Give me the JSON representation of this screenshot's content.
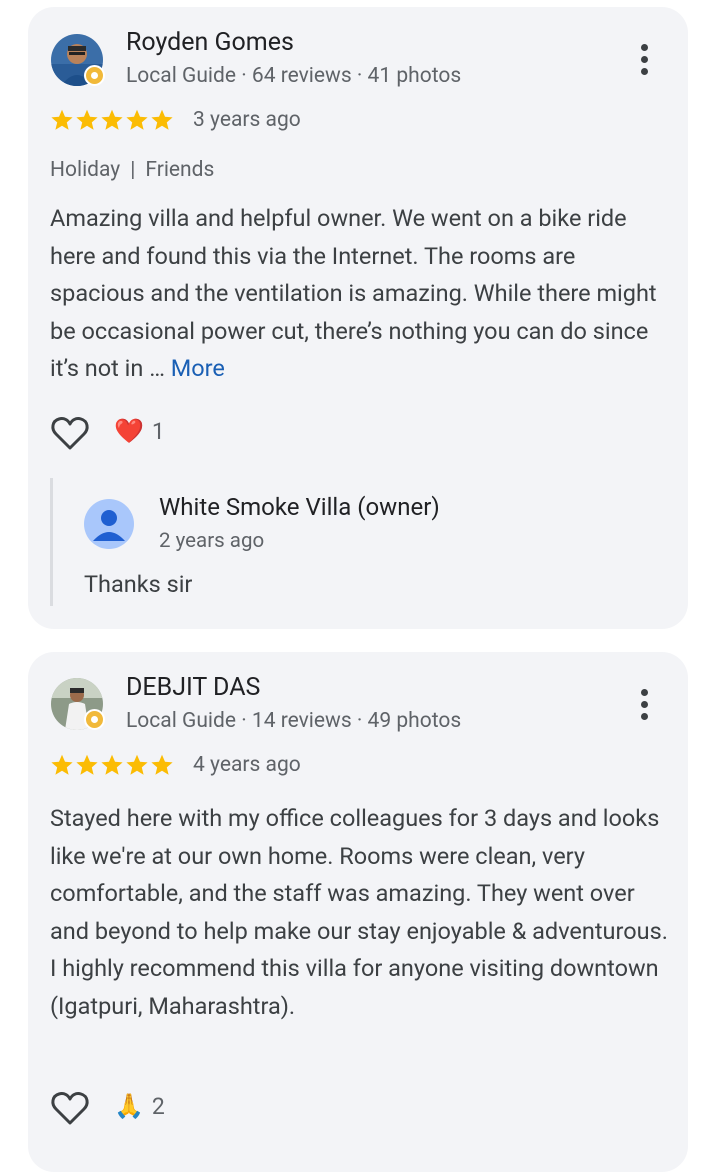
{
  "reviews": [
    {
      "name": "Royden Gomes",
      "meta": "Local Guide · 64 reviews · 41 photos",
      "stars": 5,
      "time": "3 years ago",
      "tags": [
        "Holiday",
        "Friends"
      ],
      "text": "Amazing villa and helpful owner. We went on a bike ride here and found this via the Internet. The rooms are spacious and the ventilation is amazing. While there might be occasional power cut, there’s nothing you can do since it’s not in … ",
      "more_label": "More",
      "reaction_emoji": "❤️",
      "reaction_count": "1",
      "owner_reply": {
        "name": "White Smoke Villa (owner)",
        "time": "2 years ago",
        "text": "Thanks sir"
      }
    },
    {
      "name": "DEBJIT DAS",
      "meta": "Local Guide · 14 reviews · 49 photos",
      "stars": 5,
      "time": "4 years ago",
      "text": "Stayed here with my office colleagues for 3 days and looks like we're at our own home. Rooms were clean, very comfortable, and the staff was amazing. They went over and beyond to help make our stay enjoyable & adventurous. I highly recommend this villa for anyone visiting downtown (Igatpuri, Maharashtra).",
      "reaction_emoji": "🙏",
      "reaction_count": "2"
    }
  ],
  "colors": {
    "card_bg": "#f3f4f7",
    "star": "#fbbc04",
    "link": "#1a5fb4",
    "secondary_text": "#5f6368"
  },
  "icons": {
    "like": "heart-outline-icon",
    "menu": "more-vert-icon",
    "star": "star-icon",
    "badge": "local-guide-badge-icon"
  }
}
